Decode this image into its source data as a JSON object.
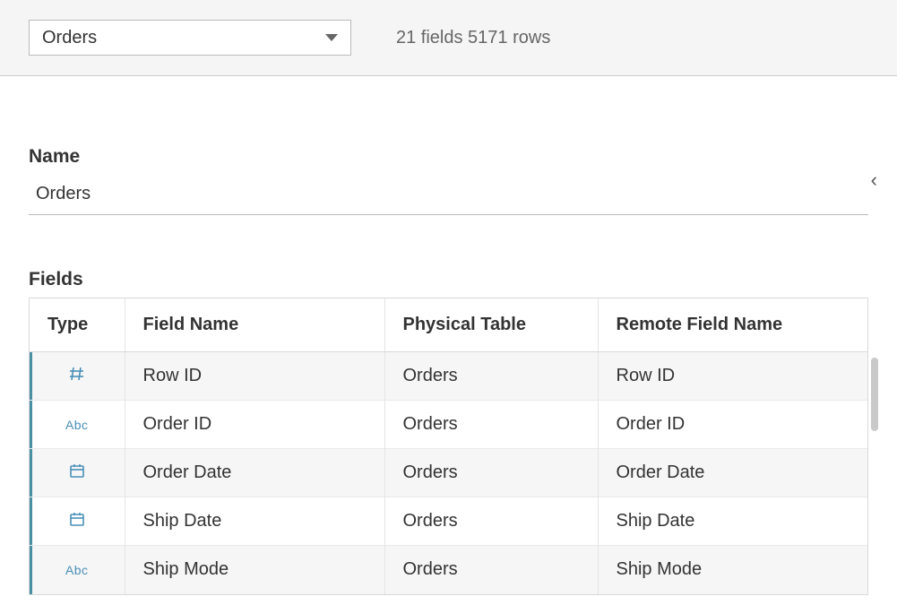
{
  "topbar": {
    "selector_value": "Orders",
    "summary": "21 fields 5171 rows"
  },
  "details": {
    "name_label": "Name",
    "name_value": "Orders",
    "fields_label": "Fields"
  },
  "table": {
    "headers": {
      "type": "Type",
      "field_name": "Field Name",
      "physical_table": "Physical Table",
      "remote_field_name": "Remote Field Name"
    },
    "rows": [
      {
        "type_icon": "number",
        "field_name": "Row ID",
        "physical_table": "Orders",
        "remote_field_name": "Row ID"
      },
      {
        "type_icon": "string",
        "type_text": "Abc",
        "field_name": "Order ID",
        "physical_table": "Orders",
        "remote_field_name": "Order ID"
      },
      {
        "type_icon": "date",
        "field_name": "Order Date",
        "physical_table": "Orders",
        "remote_field_name": "Order Date"
      },
      {
        "type_icon": "date",
        "field_name": "Ship Date",
        "physical_table": "Orders",
        "remote_field_name": "Ship Date"
      },
      {
        "type_icon": "string",
        "type_text": "Abc",
        "field_name": "Ship Mode",
        "physical_table": "Orders",
        "remote_field_name": "Ship Mode"
      }
    ]
  }
}
